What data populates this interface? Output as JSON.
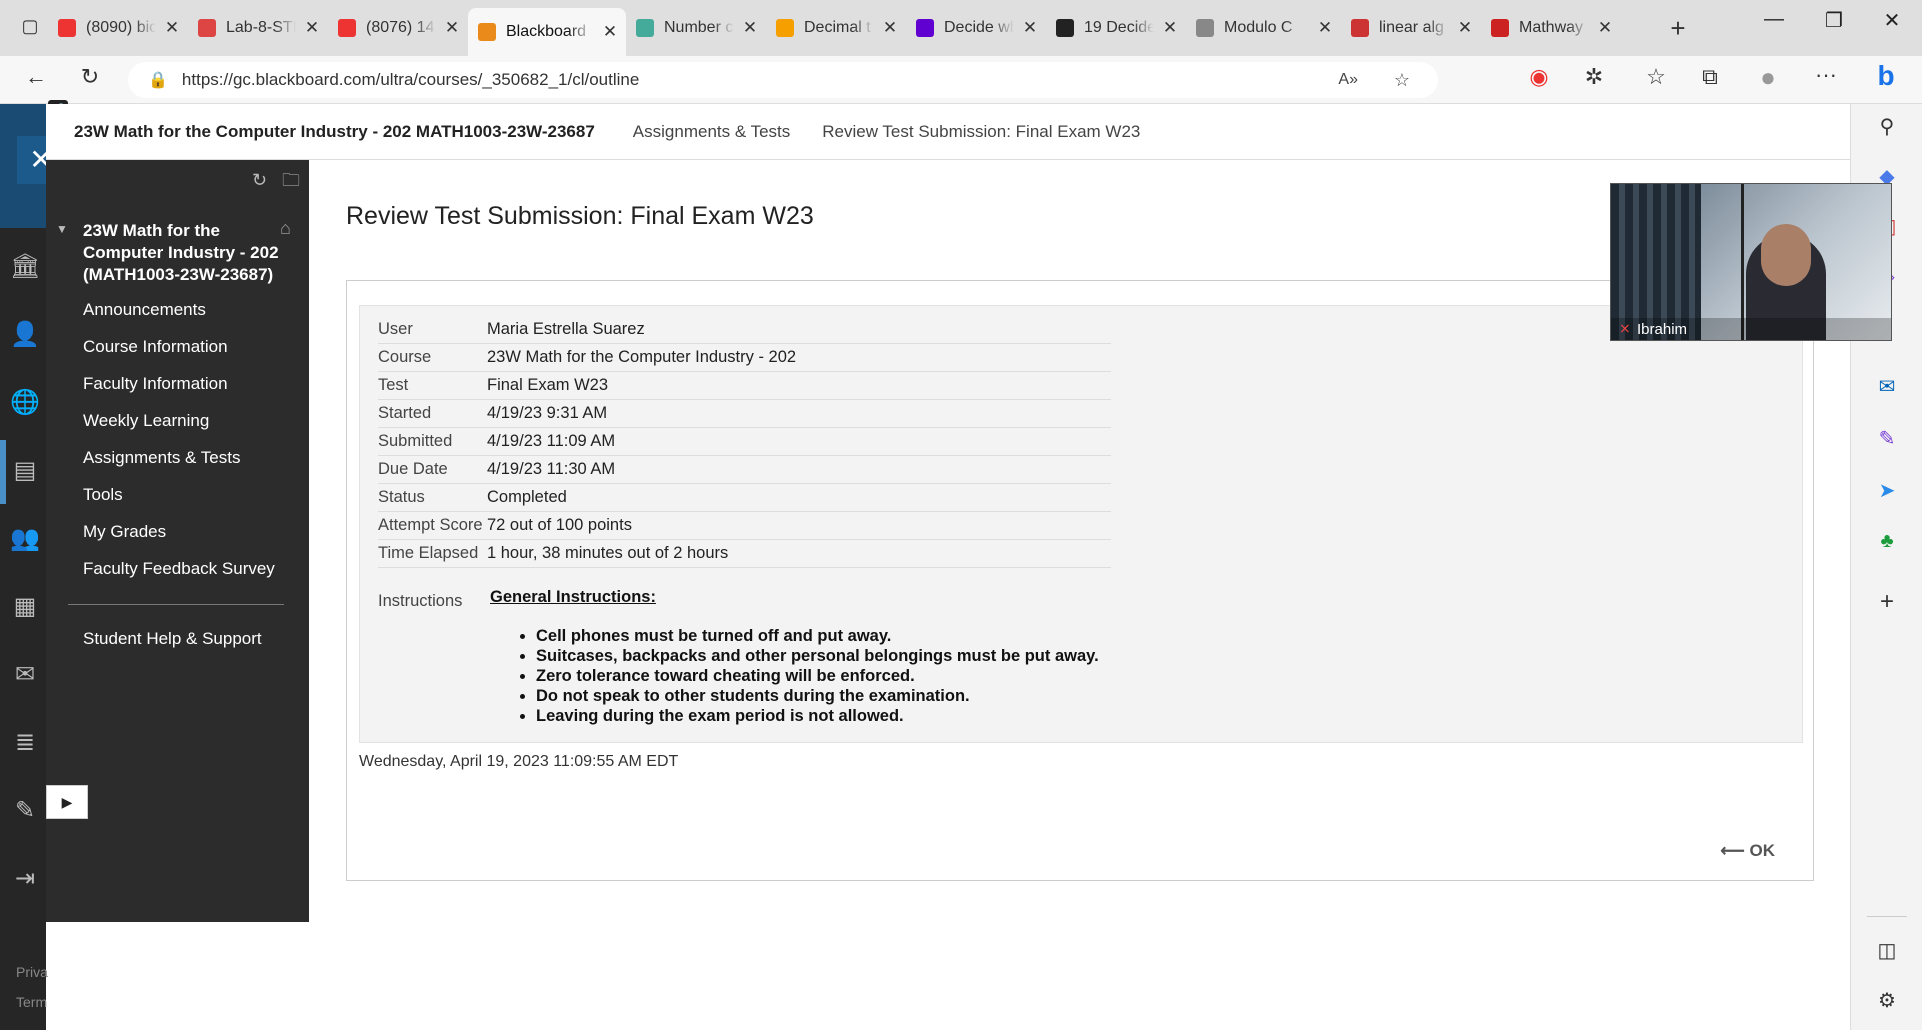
{
  "browser": {
    "tabs": [
      {
        "title": "(8090) bio",
        "icon": "youtube-icon",
        "color": "#e33"
      },
      {
        "title": "Lab-8-STI",
        "icon": "pdf-icon",
        "color": "#d44"
      },
      {
        "title": "(8076) 14",
        "icon": "youtube-icon",
        "color": "#e33"
      },
      {
        "title": "Blackboard",
        "icon": "blackboard-icon",
        "color": "#e98a1a"
      },
      {
        "title": "Number c",
        "icon": "chatgpt-icon",
        "color": "#4a9"
      },
      {
        "title": "Decimal t",
        "icon": "r-icon",
        "color": "#f5a000"
      },
      {
        "title": "Decide wh",
        "icon": "yahoo-icon",
        "color": "#6001d2"
      },
      {
        "title": "19 Decide",
        "icon": "site-icon",
        "color": "#222"
      },
      {
        "title": "Modulo C",
        "icon": "site-icon",
        "color": "#888"
      },
      {
        "title": "linear alg",
        "icon": "site-icon",
        "color": "#c33"
      },
      {
        "title": "Mathway",
        "icon": "mathway-icon",
        "color": "#c22"
      }
    ],
    "url": "https://gc.blackboard.com/ultra/courses/_350682_1/cl/outline"
  },
  "header": {
    "course_title": "23W Math for the Computer Industry - 202 MATH1003-23W-23687",
    "breadcrumb_1": "Assignments & Tests",
    "breadcrumb_2": "Review Test Submission: Final Exam W23"
  },
  "sidebar": {
    "course_name": "23W Math for the Computer Industry - 202 (MATH1003-23W-23687)",
    "items": [
      "Announcements",
      "Course Information",
      "Faculty Information",
      "Weekly Learning",
      "Assignments & Tests",
      "Tools",
      "My Grades",
      "Faculty Feedback Survey"
    ],
    "help": "Student Help & Support"
  },
  "leftnav": {
    "privacy": "Priva",
    "terms": "Term"
  },
  "main": {
    "page_title": "Review Test Submission: Final Exam W23",
    "details": [
      {
        "label": "User",
        "value": "Maria Estrella Suarez"
      },
      {
        "label": "Course",
        "value": "23W Math for the Computer Industry - 202"
      },
      {
        "label": "Test",
        "value": "Final Exam W23"
      },
      {
        "label": "Started",
        "value": "4/19/23 9:31 AM"
      },
      {
        "label": "Submitted",
        "value": "4/19/23 11:09 AM"
      },
      {
        "label": "Due Date",
        "value": "4/19/23 11:30 AM"
      },
      {
        "label": "Status",
        "value": "Completed"
      },
      {
        "label": "Attempt Score",
        "value": "72 out of 100 points"
      },
      {
        "label": "Time Elapsed",
        "value": "1 hour, 38 minutes out of 2 hours"
      }
    ],
    "instructions_label": "Instructions",
    "instructions_heading": "General Instructions:",
    "instructions": [
      "Cell phones must be turned off and put away.",
      "Suitcases, backpacks and other personal belongings must be put away.",
      "Zero tolerance toward cheating will be enforced.",
      "Do not speak to other students during the examination.",
      "Leaving during the exam period is not allowed."
    ],
    "timestamp": "Wednesday, April 19, 2023 11:09:55 AM EDT",
    "ok_label": "OK",
    "ok_arrow": "⟵"
  },
  "video": {
    "name": "Ibrahim"
  }
}
